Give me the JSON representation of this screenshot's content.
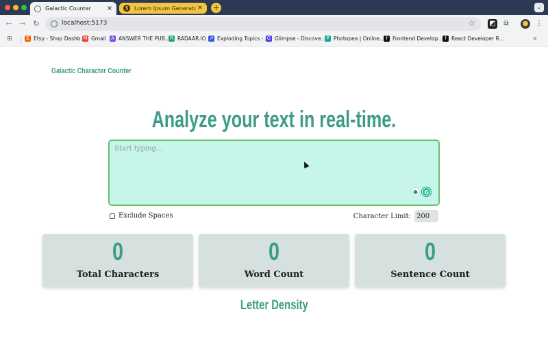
{
  "browser": {
    "tabs": [
      {
        "title": "Galactic Counter",
        "active": true
      },
      {
        "title": "Lorem Ipsum Generator",
        "active": false,
        "icon": "dollar-icon"
      }
    ],
    "new_tab_label": "+",
    "url": "localhost:5173",
    "bookmarks": [
      {
        "label": "Etsy - Shop Dashb...",
        "icon": "etsy-icon",
        "color": "#f56400"
      },
      {
        "label": "Gmail",
        "icon": "gmail-icon",
        "color": "#ea4335"
      },
      {
        "label": "ANSWER THE PUB...",
        "icon": "answer-the-public-icon",
        "color": "#7a4fd6"
      },
      {
        "label": "RADAAR.IO",
        "icon": "radaar-icon",
        "color": "#25a36f"
      },
      {
        "label": "Exploding Topics -...",
        "icon": "exploding-topics-icon",
        "color": "#3b5bdb"
      },
      {
        "label": "Glimpse - Discove...",
        "icon": "glimpse-icon",
        "color": "#4c3bdb"
      },
      {
        "label": "Photopea | Online...",
        "icon": "photopea-icon",
        "color": "#18a497"
      },
      {
        "label": "Frontend Develop...",
        "icon": "frontend-mentor-icon",
        "color": "#111111"
      },
      {
        "label": "React Developer R...",
        "icon": "frontend-mentor-icon",
        "color": "#111111"
      }
    ]
  },
  "app": {
    "brand": "Galactic Character Counter",
    "headline": "Analyze your text in real-time.",
    "textarea": {
      "placeholder": "Start typing...",
      "value": ""
    },
    "exclude_spaces_label": "Exclude Spaces",
    "exclude_spaces_checked": false,
    "character_limit_label": "Character Limit:",
    "character_limit_value": "200",
    "stats": [
      {
        "value": "0",
        "label": "Total Characters"
      },
      {
        "value": "0",
        "label": "Word Count"
      },
      {
        "value": "0",
        "label": "Sentence Count"
      }
    ],
    "letter_density_title": "Letter Density"
  },
  "colors": {
    "accent": "#3d9b86",
    "textarea_bg": "#c6f5ea",
    "textarea_border": "#6cc16b",
    "card_bg": "#d5e0df"
  }
}
